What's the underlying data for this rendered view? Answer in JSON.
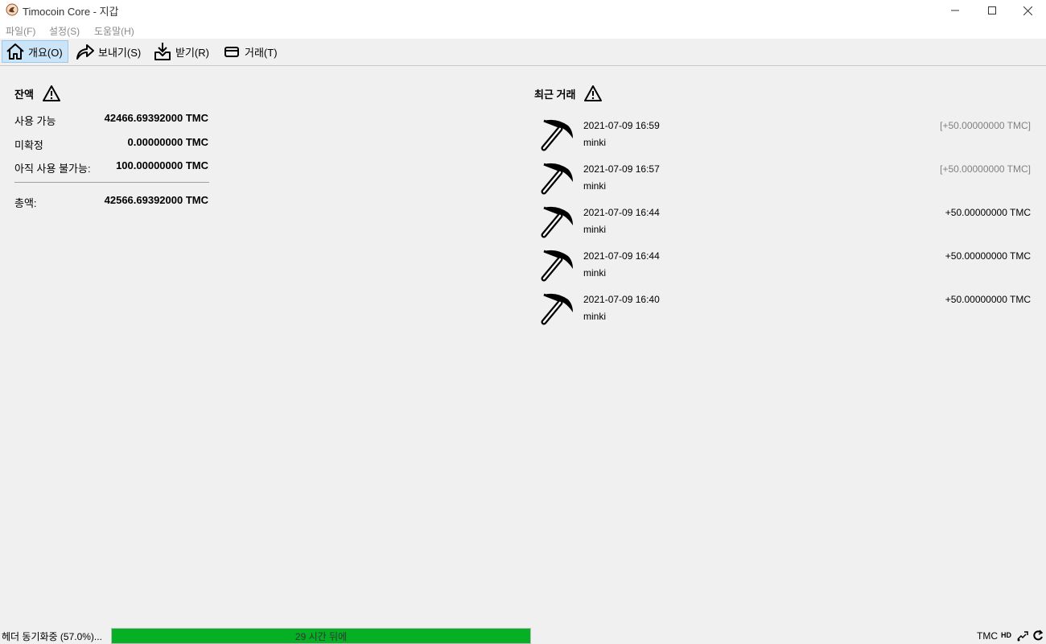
{
  "window": {
    "title": "Timocoin Core - 지갑"
  },
  "menu": {
    "file": "파일(F)",
    "settings": "설정(S)",
    "help": "도움말(H)"
  },
  "toolbar": {
    "overview": "개요(O)",
    "send": "보내기(S)",
    "receive": "받기(R)",
    "transactions": "거래(T)"
  },
  "balances": {
    "title": "잔액",
    "available_label": "사용 가능",
    "available_value": "42466.69392000 TMC",
    "pending_label": "미확정",
    "pending_value": "0.00000000 TMC",
    "immature_label": "아직 사용 불가능:",
    "immature_value": "100.00000000 TMC",
    "total_label": "총액:",
    "total_value": "42566.69392000 TMC"
  },
  "recent": {
    "title": "최근 거래",
    "transactions": [
      {
        "date": "2021-07-09 16:59",
        "label": "minki",
        "amount": "[+50.00000000 TMC]",
        "confirmed": false
      },
      {
        "date": "2021-07-09 16:57",
        "label": "minki",
        "amount": "[+50.00000000 TMC]",
        "confirmed": false
      },
      {
        "date": "2021-07-09 16:44",
        "label": "minki",
        "amount": "+50.00000000 TMC",
        "confirmed": true
      },
      {
        "date": "2021-07-09 16:44",
        "label": "minki",
        "amount": "+50.00000000 TMC",
        "confirmed": true
      },
      {
        "date": "2021-07-09 16:40",
        "label": "minki",
        "amount": "+50.00000000 TMC",
        "confirmed": true
      }
    ]
  },
  "status": {
    "sync_text": "헤더 동기화중 (57.0%)...",
    "progress_text": "29 시간 뒤에",
    "progress_fraction": 1.0,
    "progress_color": "#06b025",
    "unit": "TMC",
    "hd": "HD",
    "icons": [
      "hd-icon",
      "network-icon",
      "sync-icon"
    ]
  }
}
